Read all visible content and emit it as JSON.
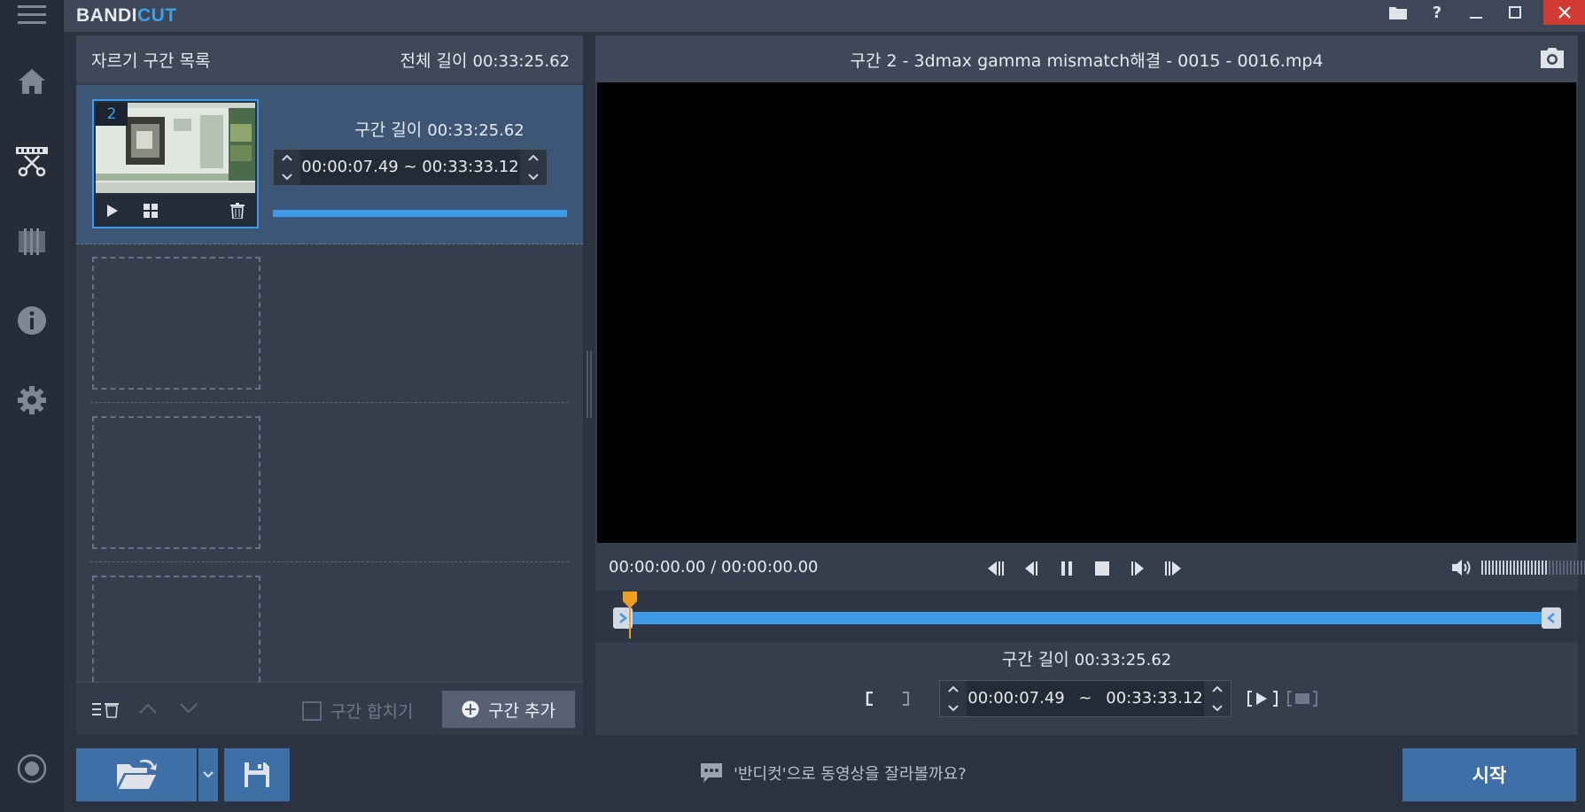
{
  "app": {
    "logo_main": "BANDI",
    "logo_accent": "CUT"
  },
  "colors": {
    "accent": "#3f9be7",
    "button": "#3e6fa6",
    "close": "#d13b32",
    "playhead": "#f0a020"
  },
  "nav": {
    "items": [
      {
        "icon": "menu-icon"
      },
      {
        "icon": "home-icon"
      },
      {
        "icon": "cut-icon"
      },
      {
        "icon": "film-icon"
      },
      {
        "icon": "info-icon"
      },
      {
        "icon": "settings-icon"
      },
      {
        "icon": "record-icon"
      }
    ]
  },
  "window": {
    "icons": [
      "folder-icon",
      "help-icon",
      "minimize-icon",
      "maximize-icon",
      "close-icon"
    ],
    "help_label": "?"
  },
  "segment_list": {
    "title": "자르기 구간 목록",
    "total_label": "전체 길이",
    "total_value": "00:33:25.62",
    "segments": [
      {
        "number": "2",
        "length_label": "구간 길이",
        "length_value": "00:33:25.62",
        "range": "00:00:07.49 ~ 00:33:33.12"
      }
    ],
    "merge_label": "구간 합치기",
    "merge_checked": false,
    "add_label": "구간 추가"
  },
  "preview": {
    "title": "구간 2 - 3dmax gamma mismatch해결 - 0015 - 0016.mp4",
    "current_time": "00:00:00.00",
    "time_separator": "/",
    "total_time": "00:00:00.00",
    "volume_fraction": 0.52,
    "segment_length_label": "구간 길이",
    "segment_length_value": "00:33:25.62",
    "range_start": "00:00:07.49",
    "range_separator": "~",
    "range_end": "00:33:33.12"
  },
  "footer": {
    "hint": "'반디컷'으로 동영상을 잘라볼까요?",
    "start_label": "시작"
  }
}
